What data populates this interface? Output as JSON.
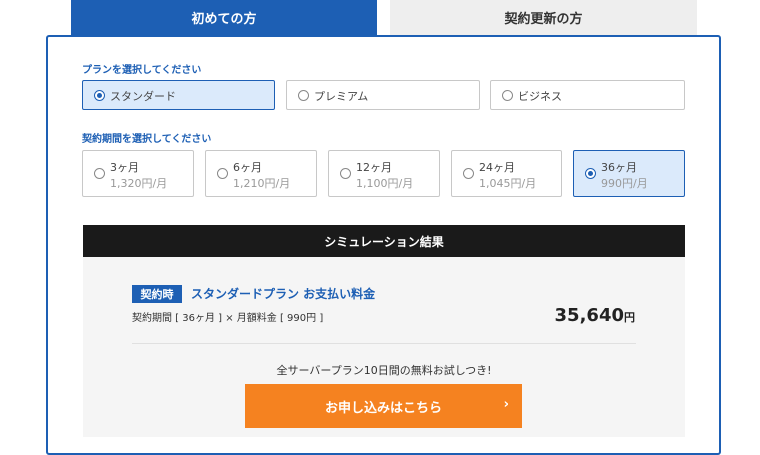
{
  "tabs": [
    {
      "label": "初めての方",
      "active": true
    },
    {
      "label": "契約更新の方",
      "active": false
    }
  ],
  "plan_section": {
    "label": "プランを選択してください",
    "options": [
      {
        "label": "スタンダード",
        "selected": true
      },
      {
        "label": "プレミアム",
        "selected": false
      },
      {
        "label": "ビジネス",
        "selected": false
      }
    ]
  },
  "term_section": {
    "label": "契約期間を選択してください",
    "options": [
      {
        "term": "3ヶ月",
        "price": "1,320円/月",
        "selected": false
      },
      {
        "term": "6ヶ月",
        "price": "1,210円/月",
        "selected": false
      },
      {
        "term": "12ヶ月",
        "price": "1,100円/月",
        "selected": false
      },
      {
        "term": "24ヶ月",
        "price": "1,045円/月",
        "selected": false
      },
      {
        "term": "36ヶ月",
        "price": "990円/月",
        "selected": true
      }
    ]
  },
  "simulation": {
    "header": "シミュレーション結果",
    "badge": "契約時",
    "title": "スタンダードプラン お支払い料金",
    "formula": "契約期間 [ 36ヶ月 ] × 月額料金 [ 990円 ]",
    "total": "35,640",
    "total_unit": "円",
    "trial_note": "全サーバープラン10日間の無料お試しつき!",
    "cta_label": "お申し込みはこちら",
    "cta_arrow": "›"
  },
  "colors": {
    "accent": "#1d5fb4",
    "cta": "#f58220",
    "header_dark": "#1a1a1a",
    "selected_bg": "#dbeafb"
  }
}
